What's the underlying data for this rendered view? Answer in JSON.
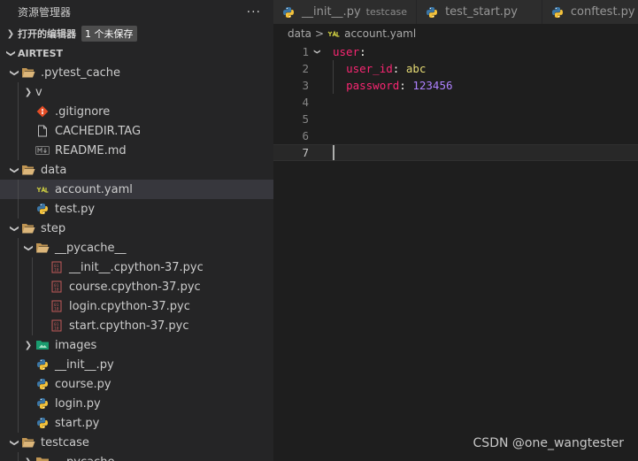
{
  "explorer": {
    "title": "资源管理器",
    "more_label": "···",
    "open_editors_label": "打开的编辑器",
    "unsaved_badge": "1 个未保存",
    "root_label": "AIRTEST",
    "tree": [
      {
        "depth": 0,
        "type": "folder",
        "open": true,
        "label": ".pytest_cache",
        "icon": "folder-open-icon"
      },
      {
        "depth": 1,
        "type": "folder",
        "open": false,
        "label": "v",
        "icon": "none"
      },
      {
        "depth": 1,
        "type": "file",
        "label": ".gitignore",
        "icon": "git-icon"
      },
      {
        "depth": 1,
        "type": "file",
        "label": "CACHEDIR.TAG",
        "icon": "file-icon"
      },
      {
        "depth": 1,
        "type": "file",
        "label": "README.md",
        "icon": "markdown-icon"
      },
      {
        "depth": 0,
        "type": "folder",
        "open": true,
        "label": "data",
        "icon": "folder-open-icon"
      },
      {
        "depth": 1,
        "type": "file",
        "label": "account.yaml",
        "icon": "yaml-icon",
        "selected": true
      },
      {
        "depth": 1,
        "type": "file",
        "label": "test.py",
        "icon": "python-icon"
      },
      {
        "depth": 0,
        "type": "folder",
        "open": true,
        "label": "step",
        "icon": "folder-open-icon"
      },
      {
        "depth": 1,
        "type": "folder",
        "open": true,
        "label": "__pycache__",
        "icon": "folder-open-icon"
      },
      {
        "depth": 2,
        "type": "file",
        "label": "__init__.cpython-37.pyc",
        "icon": "binary-icon"
      },
      {
        "depth": 2,
        "type": "file",
        "label": "course.cpython-37.pyc",
        "icon": "binary-icon"
      },
      {
        "depth": 2,
        "type": "file",
        "label": "login.cpython-37.pyc",
        "icon": "binary-icon"
      },
      {
        "depth": 2,
        "type": "file",
        "label": "start.cpython-37.pyc",
        "icon": "binary-icon"
      },
      {
        "depth": 1,
        "type": "folder",
        "open": false,
        "label": "images",
        "icon": "image-folder-icon"
      },
      {
        "depth": 1,
        "type": "file",
        "label": "__init__.py",
        "icon": "python-icon"
      },
      {
        "depth": 1,
        "type": "file",
        "label": "course.py",
        "icon": "python-icon"
      },
      {
        "depth": 1,
        "type": "file",
        "label": "login.py",
        "icon": "python-icon"
      },
      {
        "depth": 1,
        "type": "file",
        "label": "start.py",
        "icon": "python-icon"
      },
      {
        "depth": 0,
        "type": "folder",
        "open": true,
        "label": "testcase",
        "icon": "folder-open-icon"
      },
      {
        "depth": 1,
        "type": "folder",
        "open": false,
        "label": "__pycache__",
        "icon": "folder-icon"
      }
    ]
  },
  "tabs": [
    {
      "label": "__init__.py",
      "description": "testcase",
      "icon": "python-icon",
      "active": false
    },
    {
      "label": "test_start.py",
      "description": "",
      "icon": "python-icon",
      "active": false
    },
    {
      "label": "conftest.py",
      "description": "",
      "icon": "python-icon",
      "active": false
    }
  ],
  "breadcrumb": {
    "folder": "data",
    "separator": ">",
    "file": "account.yaml"
  },
  "editor": {
    "line_numbers": [
      "1",
      "2",
      "3",
      "4",
      "5",
      "6",
      "7"
    ],
    "current_line": 7,
    "line1_key": "user",
    "line2_key": "user_id",
    "line2_value": "abc",
    "line3_key": "password",
    "line3_value": "123456"
  },
  "watermark": "CSDN @one_wangtester",
  "colors": {
    "sidebar_bg": "#252526",
    "editor_bg": "#1e1e1e",
    "selection_bg": "#37373d",
    "yaml_key": "#f92672",
    "yaml_string": "#e6db74",
    "yaml_number": "#ae81ff"
  }
}
